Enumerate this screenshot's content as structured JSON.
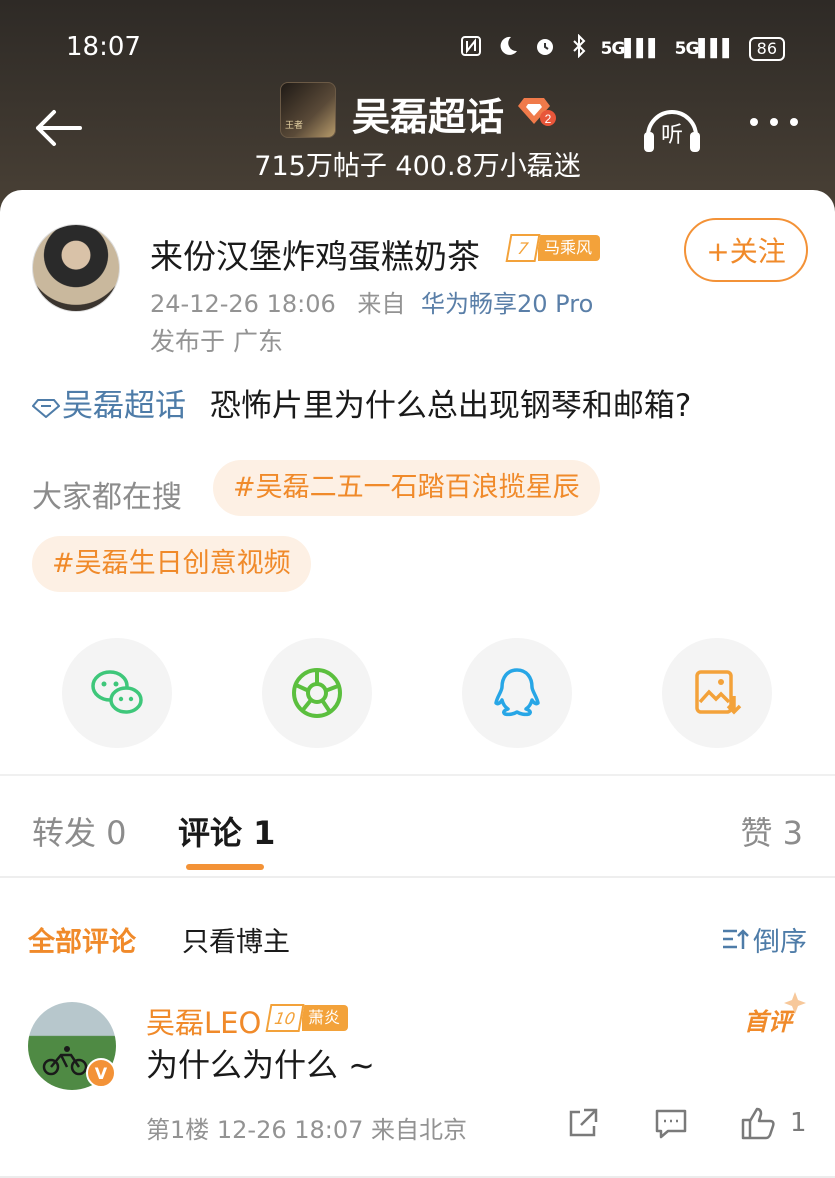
{
  "status_bar": {
    "time": "18:07",
    "battery": "86",
    "net1": "5G",
    "net2": "5G"
  },
  "header": {
    "topic_title": "吴磊超话",
    "posts_count": "715万帖子",
    "fans_count": "400.8万小磊迷",
    "topic_logo_text": "王者",
    "topic_level": "2"
  },
  "post": {
    "author_name": "来份汉堡炸鸡蛋糕奶茶",
    "author_level": "7",
    "author_level_name": "马乘风",
    "follow_label": "+关注",
    "time": "24-12-26 18:06",
    "source_prefix": "来自",
    "device": "华为畅享20 Pro",
    "location": "发布于 广东",
    "topic_link": "吴磊超话",
    "content": "恐怖片里为什么总出现钢琴和邮箱?"
  },
  "search": {
    "label": "大家都在搜",
    "tags": [
      "#吴磊二五一石踏百浪揽星辰",
      "#吴磊生日创意视频"
    ]
  },
  "share_buttons": [
    {
      "name": "wechat",
      "icon": "wechat-icon",
      "color": "#3ec77a"
    },
    {
      "name": "moments",
      "icon": "moments-icon",
      "color": "#5bbf3e"
    },
    {
      "name": "qq",
      "icon": "qq-icon",
      "color": "#27a6e6"
    },
    {
      "name": "save-image",
      "icon": "save-image-icon",
      "color": "#f3a23a"
    }
  ],
  "tabs": {
    "repost": "转发 0",
    "comment": "评论 1",
    "like": "赞 3"
  },
  "filter": {
    "all": "全部评论",
    "blogger_only": "只看博主",
    "sort": "倒序"
  },
  "comments": [
    {
      "name": "吴磊LEO",
      "level": "10",
      "level_name": "萧炎",
      "first_badge": "首评",
      "text": "为什么为什么 ~",
      "meta": "第1楼 12-26 18:07 来自北京",
      "likes": "1"
    }
  ],
  "colors": {
    "accent": "#f39237",
    "link": "#4e7ca8"
  }
}
